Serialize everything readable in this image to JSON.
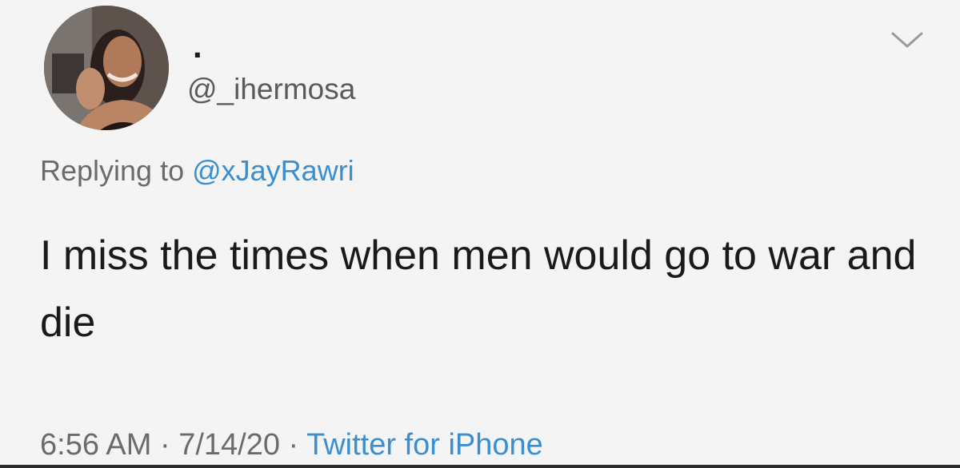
{
  "tweet": {
    "display_name": ".",
    "handle": "@_ihermosa",
    "reply_prefix": "Replying to ",
    "reply_to": "@xJayRawri",
    "text": "I miss the times when men would go to war and die",
    "time": "6:56 AM",
    "date": "7/14/20",
    "source": "Twitter for iPhone",
    "separator": " · "
  },
  "icons": {
    "avatar": "profile-photo",
    "menu": "chevron-down-icon"
  },
  "colors": {
    "background": "#f4f4f4",
    "text": "#1a1a1a",
    "muted": "#6b6b6b",
    "link": "#3a8fd0"
  }
}
